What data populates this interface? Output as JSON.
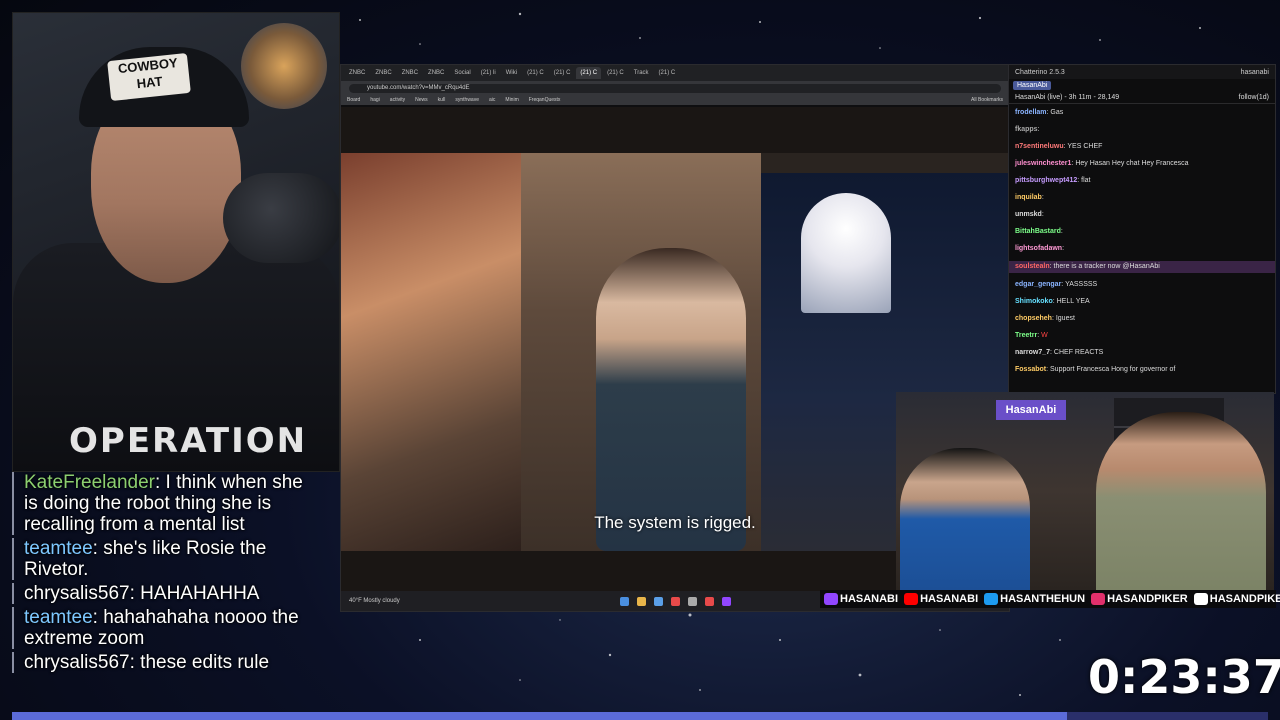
{
  "streamer_cam": {
    "cap_text": "COWBOY HAT",
    "shirt_text": "OPERATION"
  },
  "overlay_chat": [
    {
      "user": "KateFreelander",
      "user_color": "#8ccf70",
      "text": "I think when she is doing the robot thing she is recalling from a mental list"
    },
    {
      "user": "teamtee",
      "user_color": "#7ec8ff",
      "text": "she's like Rosie the Rivetor."
    },
    {
      "user": "chrysalis567",
      "user_color": "#ffffff",
      "text": "HAHAHAHHA"
    },
    {
      "user": "teamtee",
      "user_color": "#7ec8ff",
      "text": "hahahahaha noooo the extreme zoom"
    },
    {
      "user": "chrysalis567",
      "user_color": "#ffffff",
      "text": "these edits rule"
    }
  ],
  "browser": {
    "tabs": [
      "ZNBC",
      "ZNBC",
      "ZNBC",
      "ZNBC",
      "Social",
      "(21) li",
      "Wiki",
      "(21) C",
      "(21) C",
      "(21) C",
      "(21) C",
      "Track",
      "(21) C"
    ],
    "active_tab_index": 9,
    "url": "youtube.com/watch?v=MMv_cRqu4dE",
    "bookmarks": [
      "Board",
      "hagi",
      "activity",
      "News",
      "kuIl",
      "synthwave",
      "aic",
      "Minim",
      "FreqanQuestx"
    ],
    "all_bookmarks": "All Bookmarks",
    "caption": "The system is rigged.",
    "weather_temp": "40°F",
    "weather_desc": "Mostly cloudy"
  },
  "chatterino": {
    "app_title": "Chatterino 2.5.3",
    "account": "hasanabi",
    "tab": "HasanAbi",
    "channel_line": "HasanAbi (live) - 3h 11m - 28,149",
    "follow": "follow(1d)",
    "messages": [
      {
        "user": "frodellam",
        "color": "#8ab4ff",
        "text": "Gas",
        "highlight": false
      },
      {
        "user": "fkapps",
        "color": "#aaaaaa",
        "text": "",
        "highlight": false
      },
      {
        "user": "n7sentineluwu",
        "color": "#ff7a7a",
        "text": "YES CHEF",
        "highlight": false
      },
      {
        "user": "juleswinchester1",
        "color": "#ff8fd0",
        "text": "Hey Hasan Hey chat Hey Francesca",
        "highlight": false
      },
      {
        "user": "pittsburghwept412",
        "color": "#c69cff",
        "text": "flat",
        "highlight": false
      },
      {
        "user": "inquilab",
        "color": "#ffcc66",
        "text": "",
        "highlight": false
      },
      {
        "user": "unmskd",
        "color": "#ffffff",
        "text": "",
        "highlight": false
      },
      {
        "user": "BittahBastard",
        "color": "#7dff8a",
        "text": "",
        "highlight": false
      },
      {
        "user": "lightsofadawn",
        "color": "#ff9ad5",
        "text": "",
        "highlight": false
      },
      {
        "user": "soulstealn",
        "color": "#ff6666",
        "text": "there is a tracker now @HasanAbi",
        "highlight": true
      },
      {
        "user": "edgar_gengar",
        "color": "#8ab4ff",
        "text": "YASSSSS",
        "highlight": false
      },
      {
        "user": "Shimokoko",
        "color": "#66e0ff",
        "text": "HELL YEA",
        "highlight": false
      },
      {
        "user": "chopseheh",
        "color": "#ffcc66",
        "text": "Iguest",
        "highlight": false
      },
      {
        "user": "Treetrr",
        "color": "#7dff8a",
        "text": "W",
        "highlight": false
      },
      {
        "user": "narrow7_7",
        "color": "#ffffff",
        "text": "CHEF REACTS",
        "highlight": false
      },
      {
        "user": "Fossabot",
        "color": "#ffcc66",
        "text": "Support Francesca Hong for governor of",
        "highlight": false
      }
    ]
  },
  "room_cam": {
    "logo": "HasanAbi"
  },
  "socials": [
    {
      "platform": "twitch-icon",
      "color": "#9146ff",
      "handle": "HASANABI"
    },
    {
      "platform": "youtube-icon",
      "color": "#ff0000",
      "handle": "HASANABI"
    },
    {
      "platform": "twitter-icon",
      "color": "#1d9bf0",
      "handle": "HASANTHEHUN"
    },
    {
      "platform": "instagram-icon",
      "color": "#e1306c",
      "handle": "HASANDPIKER"
    },
    {
      "platform": "tiktok-icon",
      "color": "#ffffff",
      "handle": "HASANDPIKER"
    }
  ],
  "timer": "0:23:37",
  "progress_fraction": 0.84,
  "colors": {
    "accent": "#5b6bd8",
    "chat_highlight": "#3a2446"
  }
}
